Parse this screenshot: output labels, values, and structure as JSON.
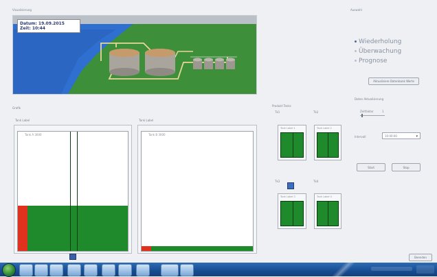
{
  "scene": {
    "title": "Visualisierung",
    "date_line1": "Datum: 19.09.2015",
    "date_line2": "Zeit: 10:44"
  },
  "section_label": "Grafik",
  "big_tanks": [
    {
      "title": "Tank Label",
      "inner_label": "Tank A 3000",
      "fill_fraction": 0.38
    },
    {
      "title": "Tank Label",
      "inner_label": "Tank B 3000",
      "fill_fraction": 0.04
    }
  ],
  "small_tanks_panel": {
    "title": "Produkt Tanks",
    "labels": [
      "Tk1",
      "Tk2",
      "Tk3",
      "Tk4"
    ],
    "inner_labels": [
      "Tank Label 1",
      "Tank Label 2",
      "Tank Label 3",
      "Tank Label 4"
    ]
  },
  "right_panel": {
    "header": "Auswahl",
    "options": [
      "Wiederholung",
      "Überwachung",
      "Prognose"
    ],
    "action_button": "Aktualisiere Datenbank Werte",
    "sub_header": "Daten Aktualisierung",
    "field_label": "Zeitfaktor",
    "field_value": "1",
    "select_label": "Intervall",
    "select_value": "10:00:00",
    "start_button": "Start",
    "stop_button": "Stop",
    "bottom_button": "Beenden"
  },
  "colors": {
    "tank_green": "#1f8a2c",
    "tank_red": "#e0301e",
    "water": "#2f6fd0",
    "grass": "#3d8f3a"
  },
  "taskbar": {
    "icons": [
      "start-orb",
      "ie-icon",
      "folder-icon",
      "media-icon",
      "app-icon",
      "word-icon",
      "explorer-icon",
      "app2-icon",
      "app3-icon",
      "app4-icon",
      "app5-icon"
    ]
  }
}
